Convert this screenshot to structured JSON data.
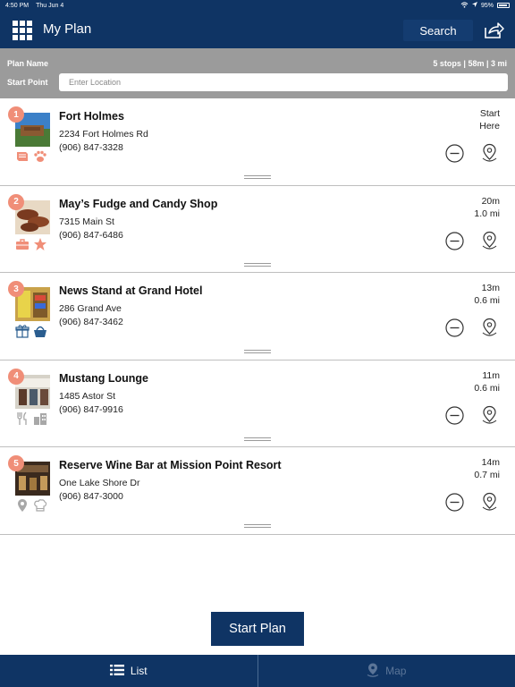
{
  "status_bar": {
    "time": "4:50 PM",
    "date": "Thu Jun 4",
    "battery": "95%"
  },
  "header": {
    "title": "My Plan",
    "search_label": "Search"
  },
  "plan": {
    "name_label": "Plan Name",
    "summary": "5 stops | 58m | 3 mi",
    "start_label": "Start Point",
    "start_placeholder": "Enter Location",
    "start_value": ""
  },
  "stops": [
    {
      "number": "1",
      "name": "Fort Holmes",
      "address": "2234 Fort Holmes Rd",
      "phone": "(906) 847-3328",
      "time": "Start",
      "distance": "Here",
      "icons": [
        "book-icon",
        "paw-icon"
      ]
    },
    {
      "number": "2",
      "name": "May’s Fudge and Candy Shop",
      "address": "7315 Main St",
      "phone": "(906) 847-6486",
      "time": "20m",
      "distance": "1.0 mi",
      "icons": [
        "briefcase-icon",
        "star-icon"
      ]
    },
    {
      "number": "3",
      "name": "News Stand at Grand Hotel",
      "address": "286 Grand Ave",
      "phone": "(906) 847-3462",
      "time": "13m",
      "distance": "0.6 mi",
      "icons": [
        "gift-icon",
        "basket-icon"
      ]
    },
    {
      "number": "4",
      "name": "Mustang Lounge",
      "address": "1485 Astor St",
      "phone": "(906) 847-9916",
      "time": "11m",
      "distance": "0.6 mi",
      "icons": [
        "fork-knife-icon",
        "buildings-icon"
      ]
    },
    {
      "number": "5",
      "name": "Reserve Wine Bar at Mission Point Resort",
      "address": "One Lake Shore Dr",
      "phone": "(906) 847-3000",
      "time": "14m",
      "distance": "0.7 mi",
      "icons": [
        "map-pin-icon",
        "chef-hat-icon"
      ]
    }
  ],
  "actions": {
    "start_plan_label": "Start Plan"
  },
  "tabs": {
    "list_label": "List",
    "map_label": "Map"
  },
  "colors": {
    "brand_navy": "#0f3464",
    "plan_bar_gray": "#9b9b9b",
    "badge_coral": "#f08e78",
    "disabled_tab": "#5b7598"
  }
}
